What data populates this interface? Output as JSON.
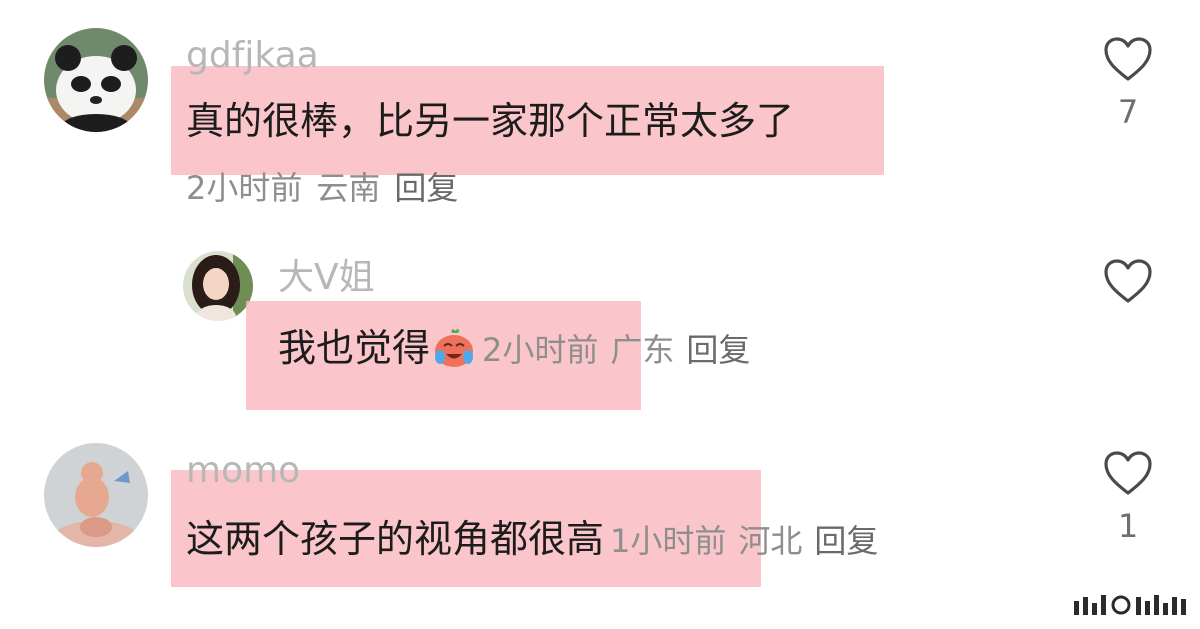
{
  "comments": [
    {
      "username": "gdfjkaa",
      "text": "真的很棒，比另一家那个正常太多了",
      "time": "2小时前",
      "location": "云南",
      "reply_label": "回复",
      "likes": "7",
      "avatar_icon": "panda-avatar"
    },
    {
      "username": "大V姐",
      "text": "我也觉得",
      "emoji": "crying-laughing-emoji",
      "time": "2小时前",
      "location": "广东",
      "reply_label": "回复",
      "likes": "",
      "avatar_icon": "woman-avatar"
    },
    {
      "username": "momo",
      "text": "这两个孩子的视角都很高",
      "time": "1小时前",
      "location": "河北",
      "reply_label": "回复",
      "likes": "1",
      "avatar_icon": "figurine-avatar"
    }
  ],
  "colors": {
    "highlight": "#f9b9c0",
    "username": "#b7b7b7",
    "text": "#1c1c1c",
    "meta": "#8e8e8e"
  },
  "icons": [
    "heart-outline-icon",
    "watermark-logo"
  ]
}
